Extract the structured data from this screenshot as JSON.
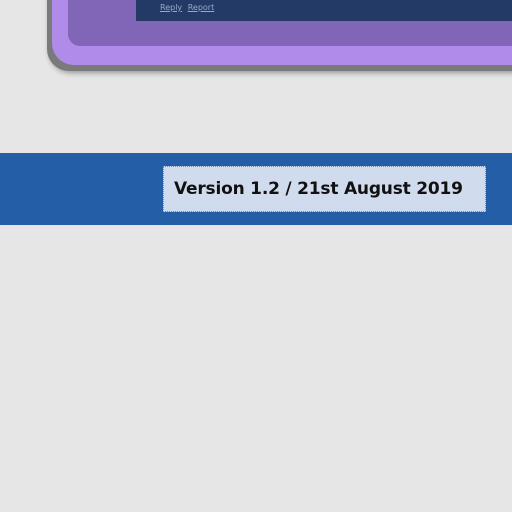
{
  "comment": {
    "reply_label": "Reply",
    "report_label": "Report"
  },
  "footer": {
    "version_text": "Version 1.2 / 21st August 2019"
  },
  "colors": {
    "page_background": "#e6e6e6",
    "card_border": "#b08bea",
    "card_inner": "#8166b7",
    "comment_bar": "#233a66",
    "version_band": "#245ea6",
    "version_box": "#d0dced"
  }
}
